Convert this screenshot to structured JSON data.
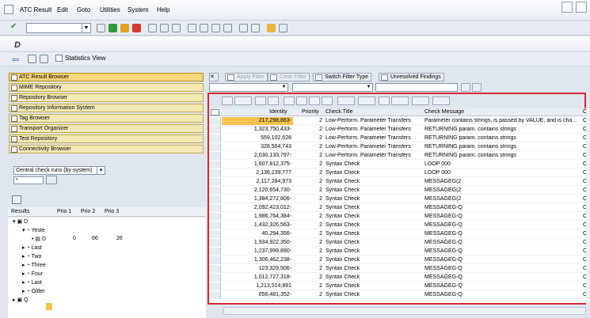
{
  "menu": [
    "ATC Result",
    "Edit",
    "Goto",
    "Utilities",
    "System",
    "Help"
  ],
  "title": "D",
  "app_toolbar": {
    "statistics": "Statistics View"
  },
  "nav": [
    "ATC Result Browser",
    "MIME Repository",
    "Repository Browser",
    "Repository Information System",
    "Tag Browser",
    "Transport Organizer",
    "Test Repository",
    "Connectivity Browser"
  ],
  "runs_select": "Central check runs (by system)",
  "filter_value": "*",
  "tree": {
    "headers": [
      "Results",
      "Prio 1",
      "Prio 2",
      "Prio 3"
    ],
    "nodes": [
      "D",
      "Yeste",
      "Last",
      "Two",
      "Three",
      "Four",
      "Last",
      "Older",
      "Q"
    ],
    "selected": {
      "label": "D",
      "p1": "0",
      "p2": "66",
      "p3": "26"
    }
  },
  "right_toolbar": {
    "apply": "Apply Filter",
    "clear": "Clear Filter",
    "switch": "Switch Filter Type",
    "unresolved": "Unresolved Findings"
  },
  "grid": {
    "headers": [
      "Identity",
      "Priority",
      "Check Title",
      "Check Message",
      "O"
    ],
    "rows": [
      [
        "217,298,863-",
        "2",
        "Low-Perform. Parameter Transfers",
        "Parameter contains strings, is passed by VALUE, and is cha...",
        "O"
      ],
      [
        "1,323,750,433-",
        "2",
        "Low-Perform. Parameter Transfers",
        "RETURNING param. contains strings",
        "O"
      ],
      [
        "559,102,628",
        "2",
        "Low-Perform. Parameter Transfers",
        "RETURNING param. contains strings",
        "O"
      ],
      [
        "328,564,743",
        "2",
        "Low-Perform. Parameter Transfers",
        "RETURNING param. contains strings",
        "O"
      ],
      [
        "2,030,133,797-",
        "2",
        "Low-Perform. Parameter Transfers",
        "RETURNING param. contains strings",
        "O"
      ],
      [
        "1,607,812,375-",
        "2",
        "Syntax Check",
        "LOOP   000",
        "O"
      ],
      [
        "2,136,239,777",
        "2",
        "Syntax Check",
        "LOOP   000",
        "O"
      ],
      [
        "2,117,284,973",
        "2",
        "Syntax Check",
        "MESSAGEG(2",
        "O"
      ],
      [
        "2,120,654,730-",
        "2",
        "Syntax Check",
        "MESSAGEG(2",
        "O"
      ],
      [
        "1,384,272,806-",
        "2",
        "Syntax Check",
        "MESSAGEG(2",
        "O"
      ],
      [
        "2,092,423,012-",
        "2",
        "Syntax Check",
        "MESSAGEG-Q",
        "O"
      ],
      [
        "1,986,764,384-",
        "2",
        "Syntax Check",
        "MESSAGEG-Q",
        "O"
      ],
      [
        "1,432,326,563-",
        "2",
        "Syntax Check",
        "MESSAGEG-Q",
        "O"
      ],
      [
        "40,294,356-",
        "2",
        "Syntax Check",
        "MESSAGEG-Q",
        "O"
      ],
      [
        "1,934,922,350-",
        "2",
        "Syntax Check",
        "MESSAGEG-Q",
        "O"
      ],
      [
        "1,237,999,890-",
        "2",
        "Syntax Check",
        "MESSAGEG-Q",
        "O"
      ],
      [
        "1,306,462,238-",
        "2",
        "Syntax Check",
        "MESSAGEG-Q",
        "O"
      ],
      [
        "123,329,506-",
        "2",
        "Syntax Check",
        "MESSAGEG-Q",
        "O"
      ],
      [
        "1,012,727,318-",
        "2",
        "Syntax Check",
        "MESSAGEG-Q",
        "O"
      ],
      [
        "1,213,514,891",
        "2",
        "Syntax Check",
        "MESSAGEG-Q",
        "O"
      ],
      [
        "656,481,352-",
        "2",
        "Syntax Check",
        "MESSAGEG-Q",
        "O"
      ]
    ]
  }
}
